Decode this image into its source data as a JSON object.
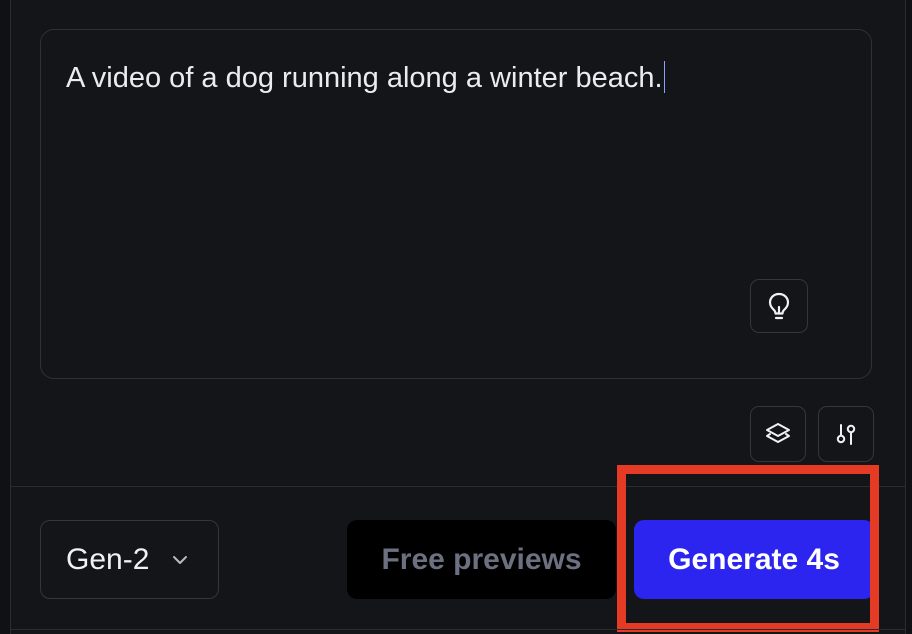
{
  "prompt": {
    "text": "A video of a dog running along a winter beach."
  },
  "toolbar": {
    "tip_icon": "lightbulb-icon",
    "layers_icon": "layers-icon",
    "settings_icon": "settings-sliders-icon"
  },
  "footer": {
    "model_label": "Gen-2",
    "model_chevron_icon": "chevron-down-icon",
    "free_previews_label": "Free previews",
    "generate_label": "Generate 4s"
  },
  "colors": {
    "background": "#141518",
    "generate_button": "#2b25ef",
    "highlight_outline": "#e53a24",
    "caret": "#8aa2ff"
  }
}
